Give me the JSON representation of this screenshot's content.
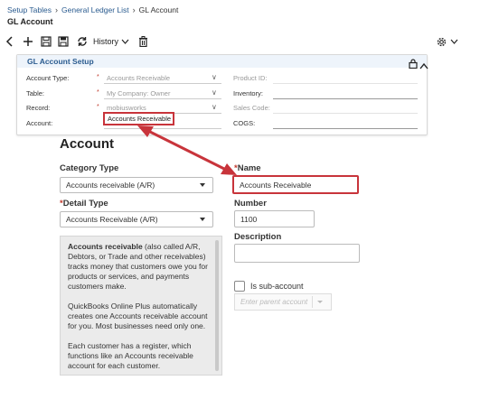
{
  "breadcrumb": {
    "items": [
      "Setup Tables",
      "General Ledger List",
      "GL Account"
    ],
    "separator": "›"
  },
  "page_title": "GL Account",
  "toolbar": {
    "history_label": "History"
  },
  "gl_setup": {
    "title": "GL Account Setup",
    "account_type_label": "Account Type:",
    "account_type_value": "Accounts Receivable",
    "table_label": "Table:",
    "table_value": "My Company: Owner",
    "record_label": "Record:",
    "record_value": "mobiusworks",
    "account_label": "Account:",
    "account_value": "Accounts Receivable",
    "product_id_label": "Product ID:",
    "inventory_label": "Inventory:",
    "sales_code_label": "Sales Code:",
    "cogs_label": "COGS:",
    "required_mark": "*"
  },
  "account_form": {
    "title": "Account",
    "category_type_label": "Category Type",
    "category_type_value": "Accounts receivable (A/R)",
    "detail_type_label": "Detail Type",
    "detail_type_value": "Accounts Receivable (A/R)",
    "required_mark": "*",
    "name_label": "Name",
    "name_value": "Accounts Receivable",
    "number_label": "Number",
    "number_value": "1100",
    "description_label": "Description",
    "subaccount_label": "Is sub-account",
    "parent_account_placeholder": "Enter parent account",
    "help_bold": "Accounts receivable",
    "help_p1_rest": " (also called A/R, Debtors, or Trade and other receivables) tracks money that customers owe you for products or services, and payments customers make.",
    "help_p2": "QuickBooks Online Plus automatically creates one Accounts receivable account for you. Most businesses need only one.",
    "help_p3": "Each customer has a register, which functions like an Accounts receivable account for each customer."
  },
  "colors": {
    "highlight": "#c8343b",
    "link": "#2a5b8f"
  }
}
